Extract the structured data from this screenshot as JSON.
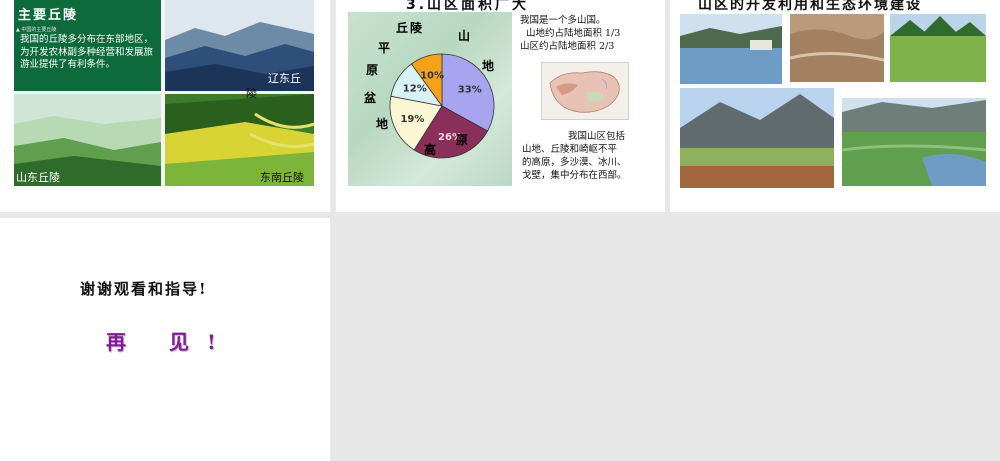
{
  "slide1": {
    "title": "主要丘陵",
    "subtitle": "▲ 中国的主要丘陵",
    "paragraph": "我国的丘陵多分布在东部地区，为开发农林副多种经营和发展旅游业提供了有利条件。",
    "captions": {
      "liaodong_a": "辽东丘",
      "liaodong_b": "陵",
      "shandong": "山东丘陵",
      "southeast": "东南丘陵"
    }
  },
  "slide2": {
    "title": "3.山区面积广大",
    "intro": [
      "我国是一个多山国。",
      "山地约占陆地面积 1/3",
      "山区约占陆地面积 2/3"
    ],
    "detail": [
      "我国山区包括",
      "山地、丘陵和崎岖不平",
      "的高原，多沙漠、冰川、",
      "戈壁，集中分布在西部。"
    ],
    "pie_labels": {
      "shan": "山",
      "di": "地",
      "gao": "高",
      "yuan": "原",
      "qiu": "丘",
      "ling": "陵",
      "ping": "平",
      "yuan2": "原",
      "pen": "盆",
      "di2": "地"
    }
  },
  "slide3": {
    "title": "山区的开发利用和生态环境建设"
  },
  "slide4": {
    "thanks": "谢谢观看和指导!",
    "bye": "再 见!"
  },
  "chart_data": {
    "type": "pie",
    "categories": [
      "山地",
      "高原",
      "盆地",
      "平原",
      "丘陵"
    ],
    "values": [
      33,
      26,
      19,
      12,
      10
    ],
    "value_labels": [
      "33%",
      "26%",
      "19%",
      "12%",
      "10%"
    ],
    "colors": [
      "#a9a4f0",
      "#8a2f5a",
      "#fbf7d4",
      "#d9f2f5",
      "#f4a21c"
    ]
  }
}
